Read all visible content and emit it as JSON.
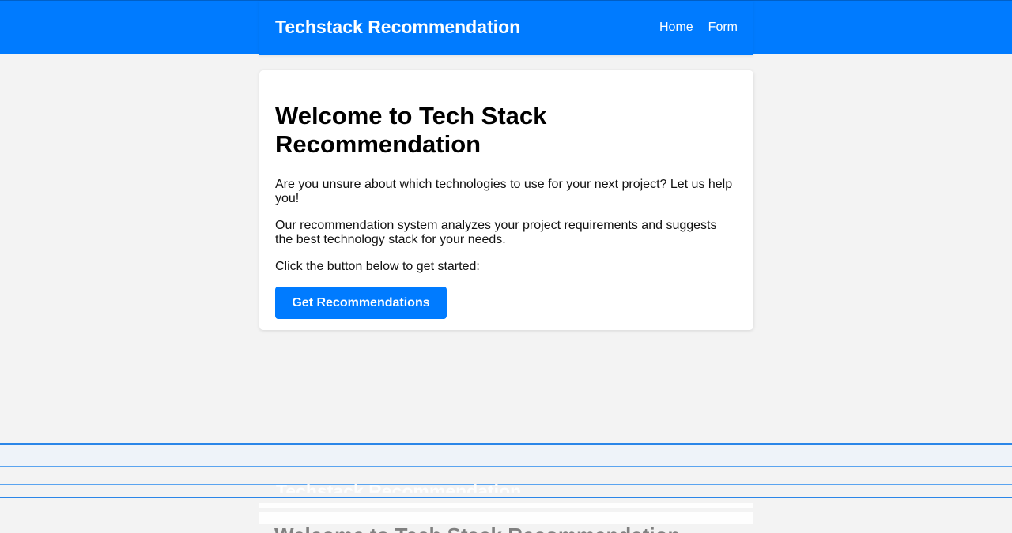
{
  "header": {
    "brand": "Techstack Recommendation",
    "nav": [
      {
        "label": "Home"
      },
      {
        "label": "Form"
      }
    ]
  },
  "main": {
    "title": "Welcome to Tech Stack Recommendation",
    "intro": "Are you unsure about which technologies to use for your next project? Let us help you!",
    "description": "Our recommendation system analyzes your project requirements and suggests the best technology stack for your needs.",
    "prompt": "Click the button below to get started:",
    "cta_label": "Get Recommendations"
  },
  "colors": {
    "primary": "#007bff",
    "background": "#f3f3f3",
    "card": "#ffffff"
  }
}
